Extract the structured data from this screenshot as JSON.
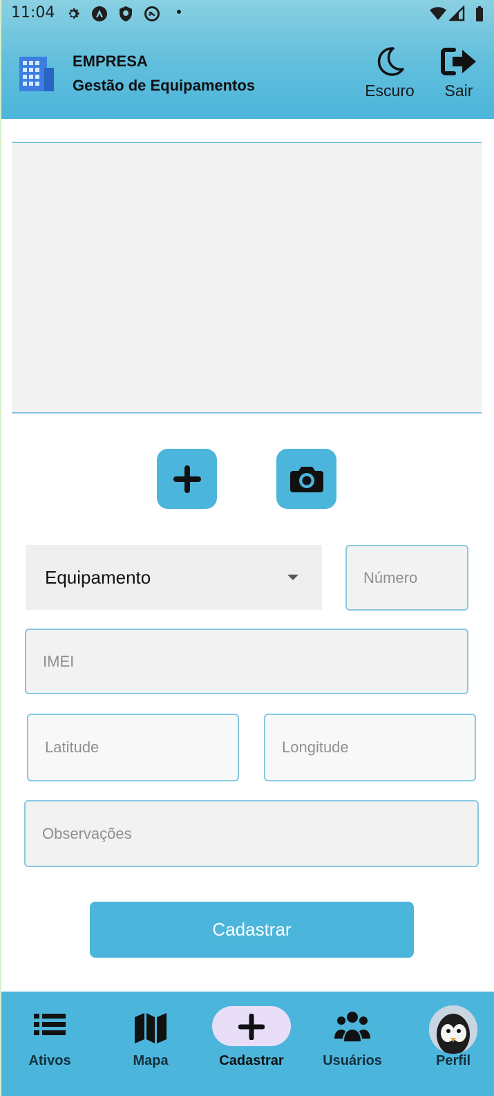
{
  "status_bar": {
    "time": "11:04",
    "icons": [
      "gear-icon",
      "a-circle-icon",
      "shield-icon",
      "sync-circle-icon",
      "dot-icon",
      "wifi-icon",
      "signal-icon",
      "battery-icon"
    ]
  },
  "header": {
    "company": "EMPRESA",
    "app_title": "Gestão de Equipamentos",
    "logo_icon": "building-icon",
    "dark_mode_label": "Escuro",
    "logout_label": "Sair"
  },
  "photo": {
    "add_icon": "plus-icon",
    "camera_icon": "camera-icon"
  },
  "form": {
    "equipment_select": "Equipamento",
    "numero_placeholder": "Número",
    "imei_placeholder": "IMEI",
    "latitude_placeholder": "Latitude",
    "longitude_placeholder": "Longitude",
    "observacoes_placeholder": "Observações",
    "submit_label": "Cadastrar"
  },
  "nav": {
    "items": [
      {
        "label": "Ativos",
        "icon": "list-icon"
      },
      {
        "label": "Mapa",
        "icon": "map-icon"
      },
      {
        "label": "Cadastrar",
        "icon": "plus-icon",
        "active": true
      },
      {
        "label": "Usuários",
        "icon": "users-icon"
      },
      {
        "label": "Perfil",
        "icon": "avatar"
      }
    ]
  },
  "colors": {
    "primary": "#4cb5db",
    "header_top": "#8ad0e2",
    "active_pill": "#e8def8",
    "field_border": "#86c9e0",
    "field_bg": "#f2f2f2"
  }
}
